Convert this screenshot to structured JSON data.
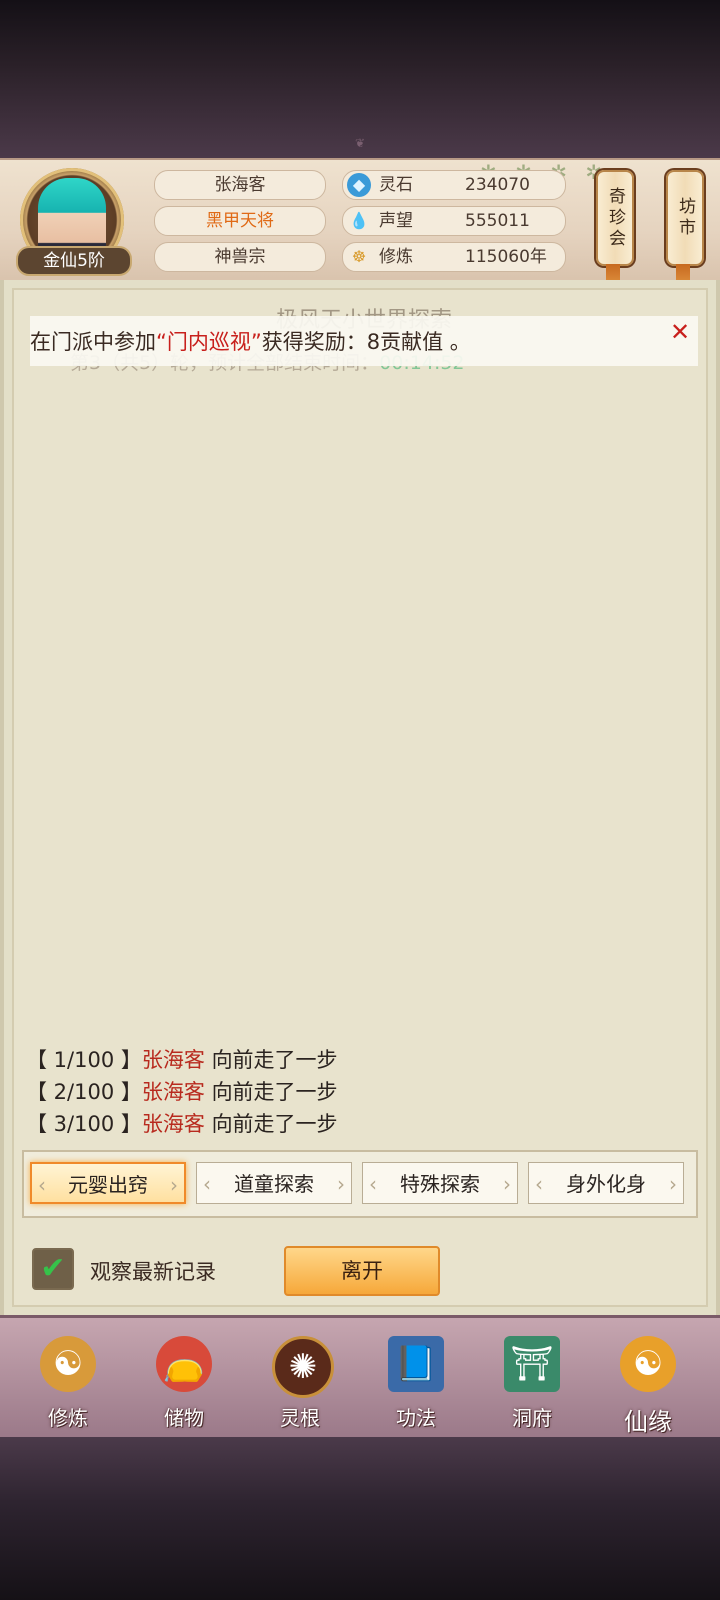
{
  "header": {
    "player_name": "张海客",
    "title": "黑甲天将",
    "sect": "神兽宗",
    "rank": "金仙5阶",
    "stats": [
      {
        "icon": "crystal-icon",
        "label": "灵石",
        "value": "234070"
      },
      {
        "icon": "droplet-icon",
        "label": "声望",
        "value": "555011"
      },
      {
        "icon": "meditation-icon",
        "label": "修炼",
        "value": "115060年"
      }
    ],
    "buttons": {
      "treasure": "奇珍会",
      "market": "坊市"
    }
  },
  "panel": {
    "title": "极风天小世界探索",
    "subtitle_prefix": "第3（共5）轮，预计全部结束时间：",
    "subtitle_time": "00:14:52"
  },
  "toast": {
    "prefix": "在门派中参加",
    "highlight": "“门内巡视”",
    "suffix": "获得奖励：8贡献值 。"
  },
  "log": [
    {
      "step": "【 1/100 】",
      "who": "张海客",
      "action": "向前走了一步"
    },
    {
      "step": "【 2/100 】",
      "who": "张海客",
      "action": "向前走了一步"
    },
    {
      "step": "【 3/100 】",
      "who": "张海客",
      "action": "向前走了一步"
    }
  ],
  "tabs": [
    "元婴出窍",
    "道童探索",
    "特殊探索",
    "身外化身"
  ],
  "controls": {
    "observe_label": "观察最新记录",
    "leave_label": "离开"
  },
  "nav": [
    "修炼",
    "储物",
    "灵根",
    "功法",
    "洞府",
    "仙缘"
  ],
  "colors": {
    "accent_orange": "#e06a16",
    "highlight_red": "#c8201c",
    "timer_green": "#34b06a"
  }
}
